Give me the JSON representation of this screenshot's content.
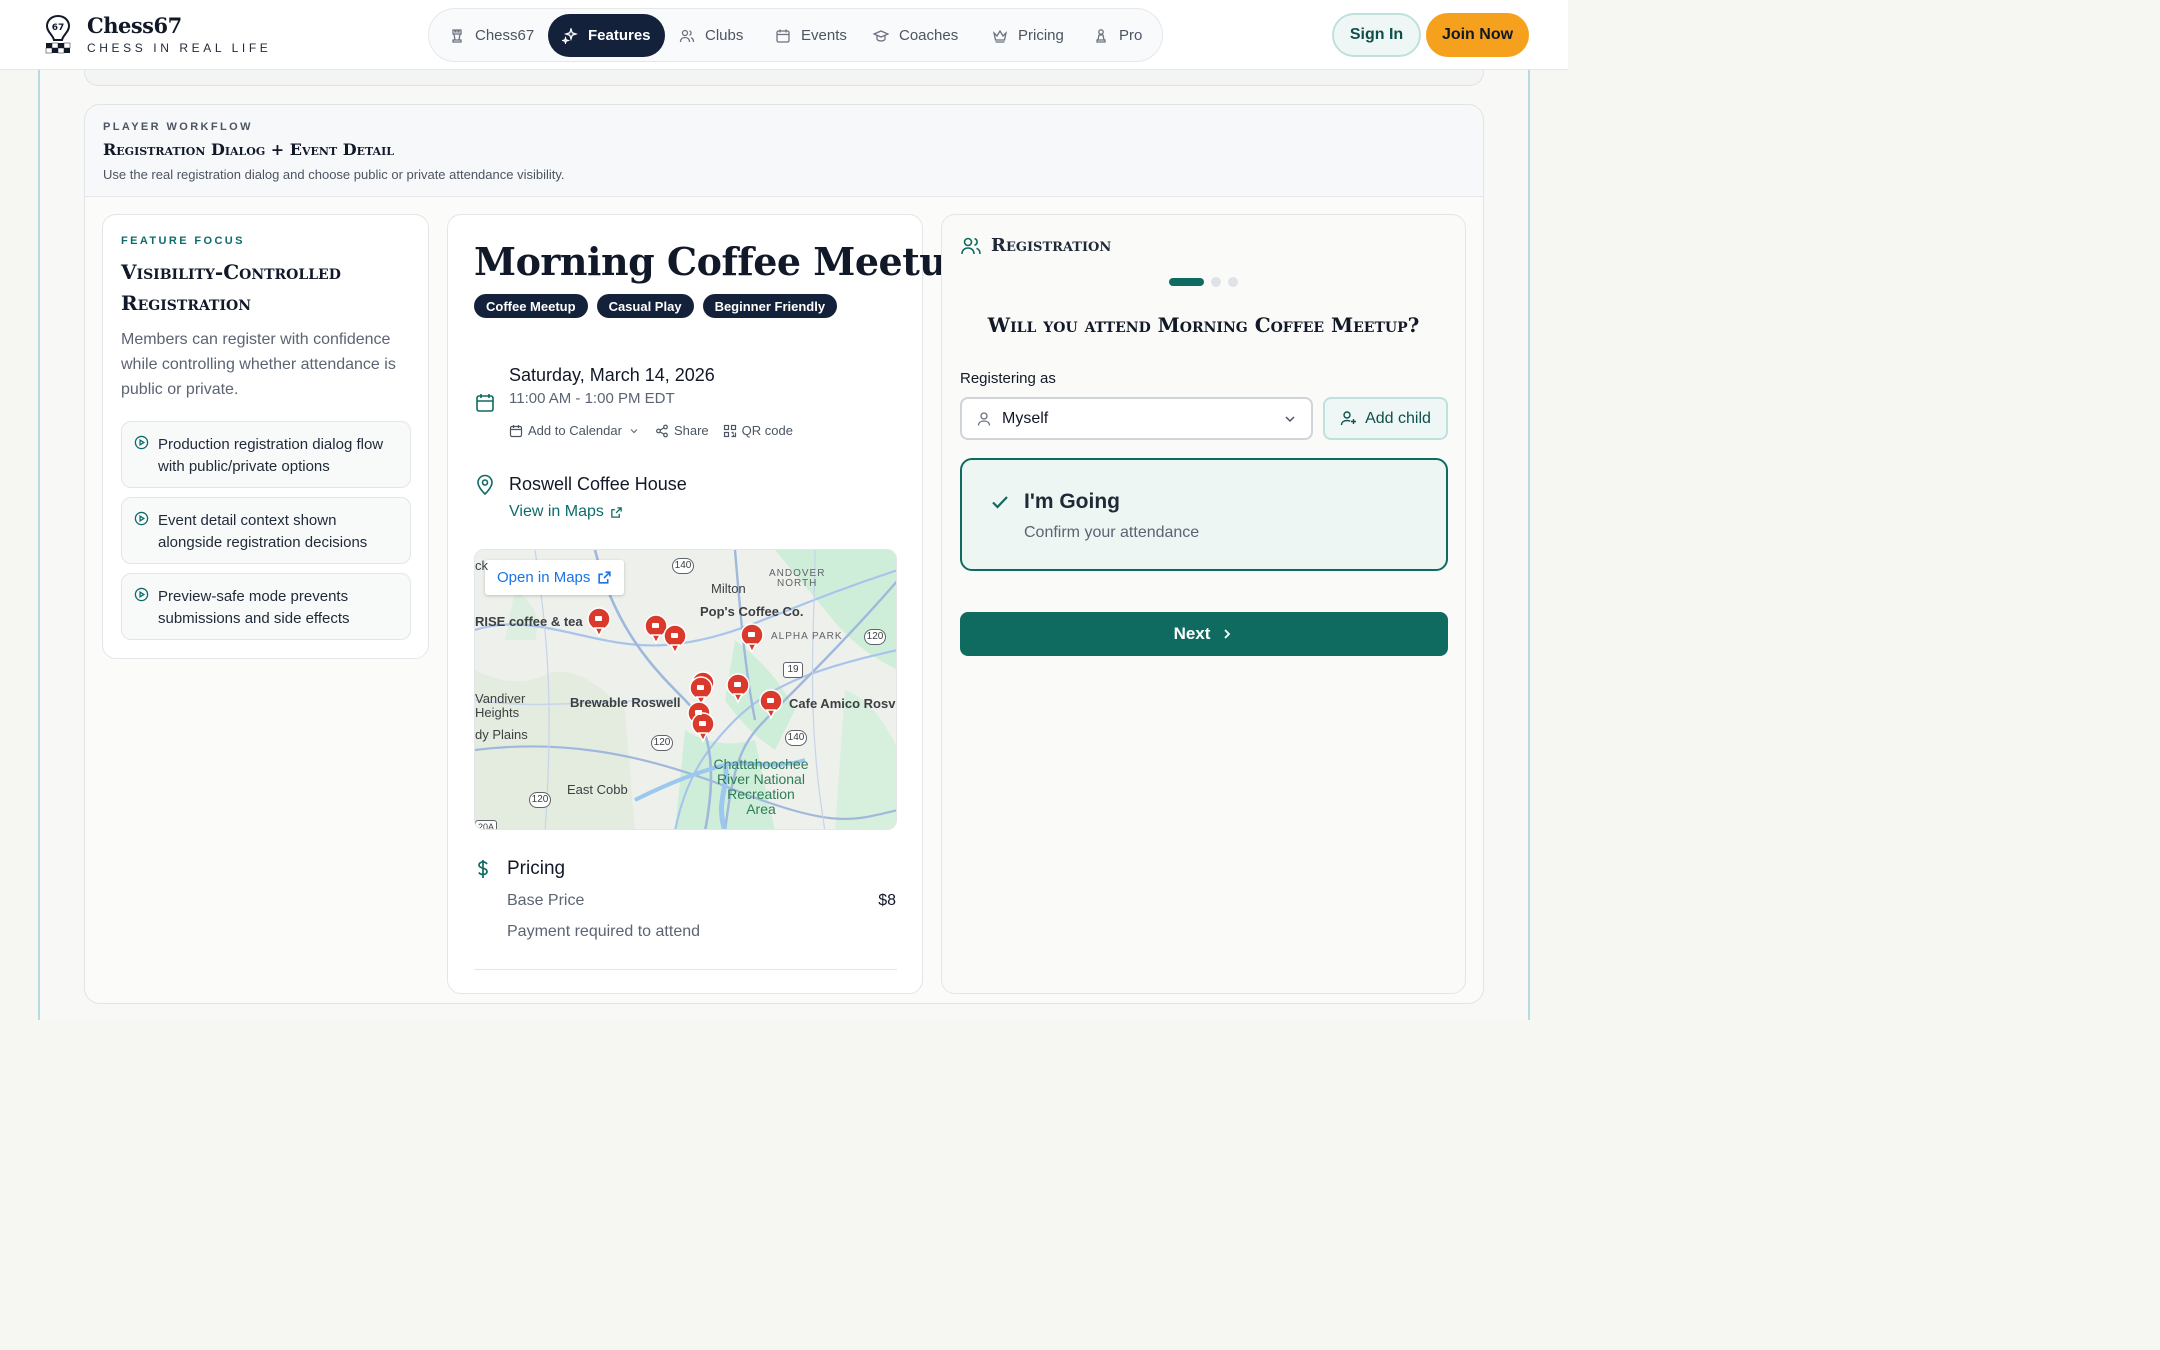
{
  "header": {
    "brand_name": "Chess67",
    "brand_tagline": "CHESS IN REAL LIFE",
    "nav": [
      {
        "label": "Chess67",
        "icon": "rook-icon"
      },
      {
        "label": "Features",
        "icon": "sparkle-icon"
      },
      {
        "label": "Clubs",
        "icon": "users-icon"
      },
      {
        "label": "Events",
        "icon": "calendar-icon"
      },
      {
        "label": "Coaches",
        "icon": "graduation-cap-icon"
      },
      {
        "label": "Pricing",
        "icon": "crown-icon"
      },
      {
        "label": "Pro",
        "icon": "pawn-icon"
      }
    ],
    "active_nav": "Features",
    "sign_in": "Sign In",
    "join_now": "Join Now"
  },
  "workflow": {
    "eyebrow": "PLAYER WORKFLOW",
    "title": "Registration Dialog + Event Detail",
    "description": "Use the real registration dialog and choose public or private attendance visibility."
  },
  "focus": {
    "eyebrow": "FEATURE FOCUS",
    "title": "Visibility-Controlled Registration",
    "description": "Members can register with confidence while controlling whether attendance is public or private.",
    "bullets": [
      "Production registration dialog flow with public/private options",
      "Event detail context shown alongside registration decisions",
      "Preview-safe mode prevents submissions and side effects"
    ]
  },
  "event": {
    "title": "Morning Coffee Meetup",
    "tags": [
      "Coffee Meetup",
      "Casual Play",
      "Beginner Friendly"
    ],
    "date": "Saturday, March 14, 2026",
    "time": "11:00 AM - 1:00 PM EDT",
    "actions": {
      "calendar": "Add to Calendar",
      "share": "Share",
      "qr": "QR code"
    },
    "venue": "Roswell Coffee House",
    "view_maps": "View in Maps",
    "map": {
      "open_button": "Open in Maps",
      "labels": {
        "milton": "Milton",
        "andover_1": "ANDOVER",
        "andover_2": "NORTH",
        "pops": "Pop's Coffee Co.",
        "alpha_park": "ALPHA PARK",
        "rise": "RISE coffee & tea",
        "vandiver_1": "Vandiver",
        "vandiver_2": "Heights",
        "brewable": "Brewable Roswell",
        "amico": "Cafe Amico Rosv",
        "dy_plains": "dy Plains",
        "chatt_1": "Chattahoochee",
        "chatt_2": "River National",
        "chatt_3": "Recreation",
        "chatt_4": "Area",
        "east_cobb": "East Cobb",
        "ck": "ck",
        "r140a": "140",
        "r120a": "120",
        "r19": "19",
        "r120b": "120",
        "r140b": "140",
        "r120c": "120",
        "r20a": "20A"
      }
    },
    "pricing_title": "Pricing",
    "base_price_label": "Base Price",
    "base_price_value": "$8",
    "payment_note": "Payment required to attend"
  },
  "registration": {
    "title": "Registration",
    "step_count": 3,
    "current_step": 1,
    "question": "Will you attend Morning Coffee Meetup?",
    "registering_as_label": "Registering as",
    "registering_as_value": "Myself",
    "add_child": "Add child",
    "going_title": "I'm Going",
    "going_subtitle": "Confirm your attendance",
    "next": "Next"
  },
  "colors": {
    "accent_teal": "#0f6b60",
    "nav_dark": "#13213a",
    "join_orange": "#f6a11d",
    "map_pin_red": "#d93a2b"
  }
}
